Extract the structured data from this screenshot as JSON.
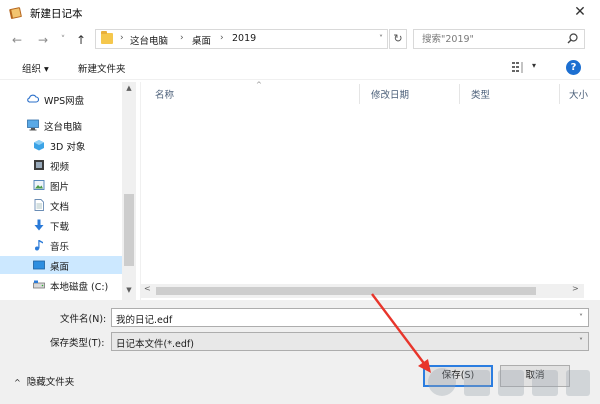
{
  "window": {
    "title": "新建日记本",
    "close_glyph": "✕"
  },
  "nav": {
    "back_glyph": "←",
    "forward_glyph": "→",
    "recent_glyph": "˅",
    "up_glyph": "↑"
  },
  "address": {
    "crumbs": [
      "这台电脑",
      "桌面",
      "2019"
    ],
    "separator": "›",
    "dropdown_glyph": "˅",
    "refresh_glyph": "↻"
  },
  "search": {
    "placeholder": "搜索\"2019\""
  },
  "toolbar": {
    "organize_label": "组织 ▾",
    "new_folder_label": "新建文件夹",
    "view_dropdown_glyph": "▾",
    "help_glyph": "?"
  },
  "sidebar": {
    "items": [
      {
        "label": "WPS网盘",
        "icon": "cloud-icon"
      },
      {
        "label": "这台电脑",
        "icon": "computer-icon"
      },
      {
        "label": "3D 对象",
        "icon": "3d-objects-icon"
      },
      {
        "label": "视频",
        "icon": "video-icon"
      },
      {
        "label": "图片",
        "icon": "pictures-icon"
      },
      {
        "label": "文档",
        "icon": "documents-icon"
      },
      {
        "label": "下载",
        "icon": "download-icon"
      },
      {
        "label": "音乐",
        "icon": "music-icon"
      },
      {
        "label": "桌面",
        "icon": "desktop-icon",
        "selected": true
      },
      {
        "label": "本地磁盘 (C:)",
        "icon": "drive-icon"
      }
    ]
  },
  "filelist": {
    "columns": [
      "名称",
      "修改日期",
      "类型",
      "大小"
    ],
    "sort_glyph": "^",
    "left_arrow": "<",
    "right_arrow": ">"
  },
  "form": {
    "filename_label": "文件名(N):",
    "filename_value": "我的日记.edf",
    "filetype_label": "保存类型(T):",
    "filetype_value": "日记本文件(*.edf)",
    "dropdown_glyph": "˅"
  },
  "footer": {
    "hide_folders_label": "隐藏文件夹",
    "hide_folders_caret": "^",
    "save_label": "保存(S)",
    "cancel_label": "取消"
  },
  "colors": {
    "accent": "#1c6fd1",
    "selection": "#cce8ff",
    "annotation_arrow": "#e8352b",
    "folder": "#f5c74c"
  }
}
